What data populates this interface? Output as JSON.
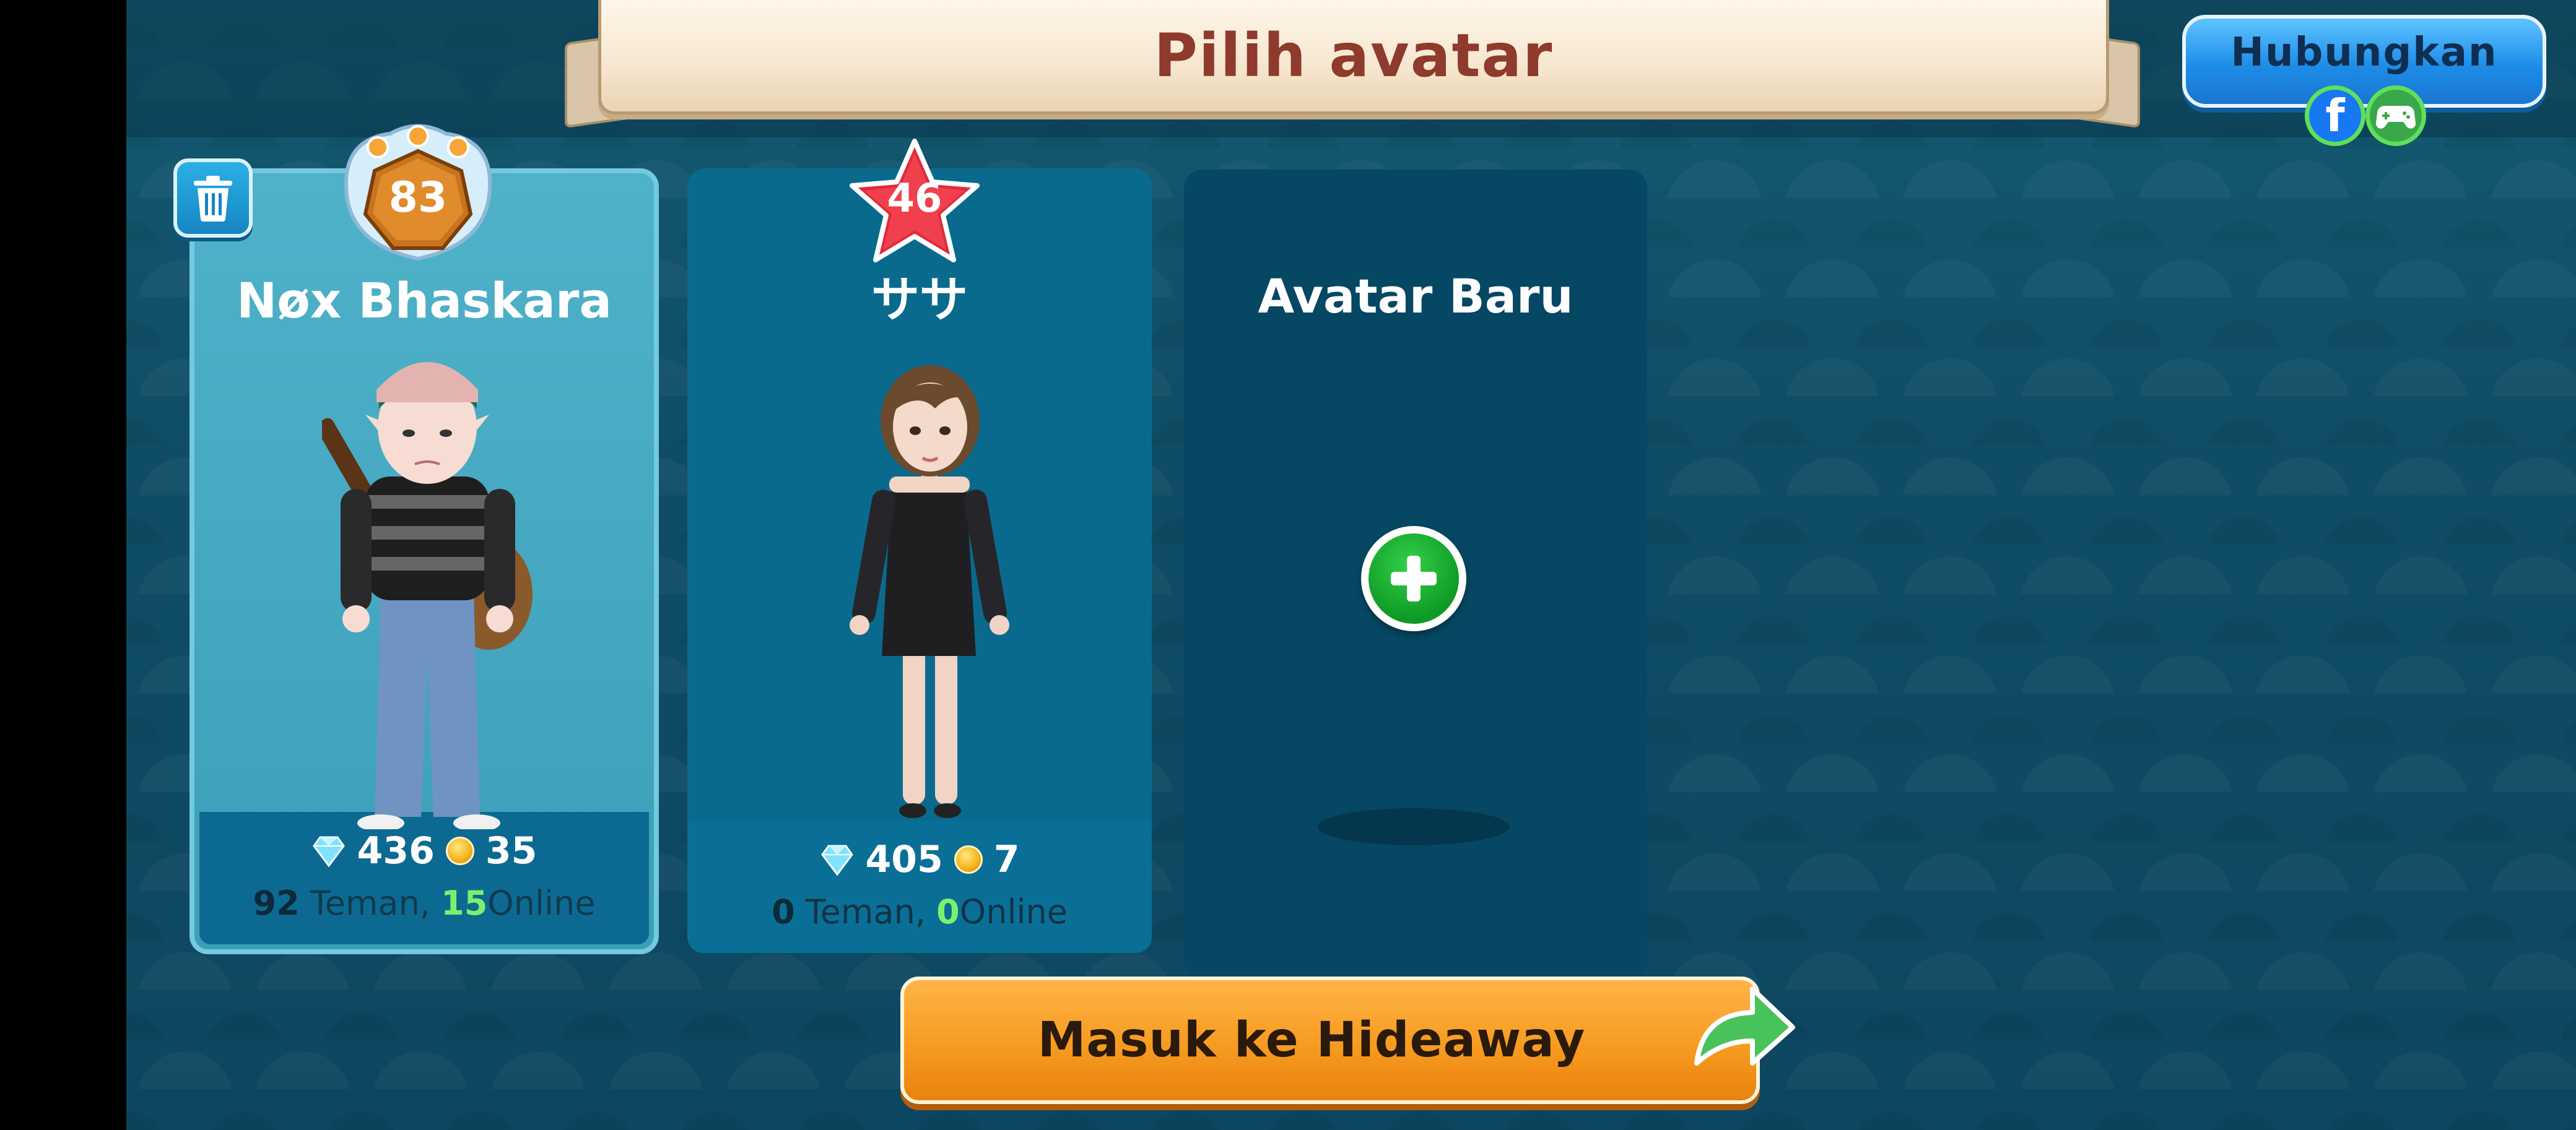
{
  "header": {
    "title": "Pilih avatar",
    "connect_label": "Hubungkan",
    "social_icons": [
      "facebook-icon",
      "game-controller-icon"
    ]
  },
  "avatars": [
    {
      "name": "Nøx Bhaskara",
      "level": "83",
      "selected": true,
      "gems": "436",
      "coins": "35",
      "friends": "92",
      "friends_label": "Teman",
      "separator": ",",
      "online": "15",
      "online_label": "Online"
    },
    {
      "name": "ササ",
      "level": "46",
      "selected": false,
      "gems": "405",
      "coins": "7",
      "friends": "0",
      "friends_label": "Teman",
      "separator": ",",
      "online": "0",
      "online_label": "Online"
    }
  ],
  "new_avatar": {
    "label": "Avatar Baru"
  },
  "enter_button": {
    "label": "Masuk ke Hideaway"
  },
  "colors": {
    "background": "#0d4a62",
    "selected_card": "#4fb2c9",
    "enter_button": "#f79b20",
    "connect_button": "#1d8de8",
    "online_count": "#7cf06c"
  }
}
